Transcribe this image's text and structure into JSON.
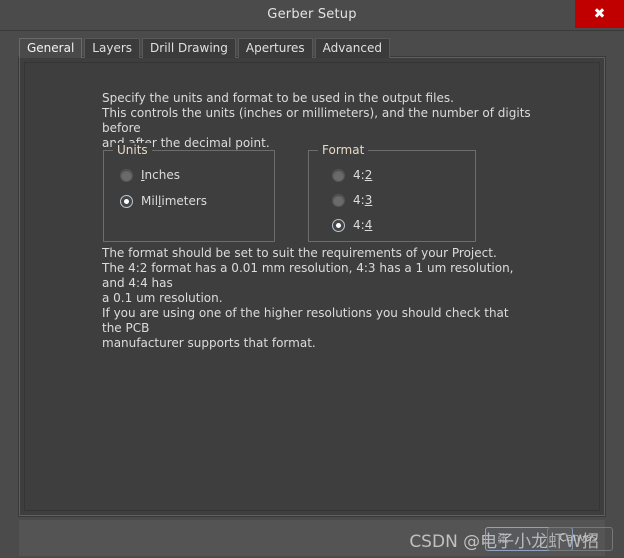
{
  "window": {
    "title": "Gerber Setup",
    "close_label": "✖",
    "close_icon": "close-icon"
  },
  "tabs": [
    {
      "label": "General",
      "active": true
    },
    {
      "label": "Layers",
      "active": false
    },
    {
      "label": "Drill Drawing",
      "active": false
    },
    {
      "label": "Apertures",
      "active": false
    },
    {
      "label": "Advanced",
      "active": false
    }
  ],
  "general": {
    "intro_text": "Specify the units and format to be used in the output files.\nThis controls the units (inches or millimeters), and the number of digits before\nand after the decimal point.",
    "footer_text": "The format should be set to suit the requirements of your Project.\nThe 4:2 format has a 0.01 mm resolution, 4:3 has a 1 um resolution, and 4:4 has\na 0.1 um resolution.\nIf you are using one of the higher resolutions you should check that the PCB\nmanufacturer supports that format.",
    "units_group": {
      "title": "Units",
      "options": [
        {
          "label": "Inches",
          "mnemonic_index": 0,
          "checked": false
        },
        {
          "label": "Millimeters",
          "mnemonic_index": 3,
          "checked": true
        }
      ]
    },
    "format_group": {
      "title": "Format",
      "options": [
        {
          "label": "4:2",
          "mnemonic_index": 2,
          "checked": false
        },
        {
          "label": "4:3",
          "mnemonic_index": 2,
          "checked": false
        },
        {
          "label": "4:4",
          "mnemonic_index": 2,
          "checked": true
        }
      ]
    }
  },
  "watermark": {
    "text": "CSDN @电子小龙虾W招",
    "ghost_text": "张",
    "ghost_text_2": "Canvas"
  },
  "colors": {
    "window_bg": "#4b4b4b",
    "panel_bg": "#3e3e3e",
    "close_red": "#c00000",
    "text": "#dcdcdc",
    "group_title": "#e6d9c8",
    "footer_bg": "#545454"
  }
}
